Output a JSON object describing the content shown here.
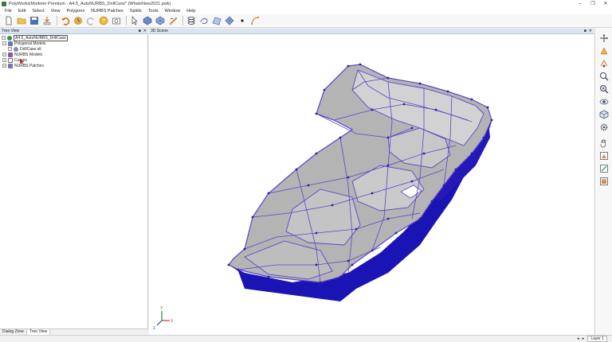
{
  "window": {
    "title": "PolyWorks|Modeler Premium - A4.5_AutoNURBS_DrillCase* (WhatsNew2021.pwk)",
    "controls": [
      "–",
      "❐",
      "✕"
    ]
  },
  "menu": [
    "File",
    "Edit",
    "Select",
    "View",
    "Polygons",
    "NURBS Patches",
    "Splids",
    "Tools",
    "Window",
    "Help"
  ],
  "toolbar": {
    "icons": [
      "new-file-icon",
      "open-folder-icon",
      "save-icon",
      "import-icon",
      "undo-icon",
      "undo-history-icon",
      "redo-icon",
      "help-icon",
      "screenshot-icon",
      "pointer-tool-icon",
      "polygon-tool-icon",
      "mesh-tool-icon",
      "ruler-icon",
      "coil-icon",
      "lasso-icon",
      "patch-icon",
      "grid-icon",
      "point-icon",
      "curve-icon"
    ]
  },
  "tree_view": {
    "header": "Tree View",
    "header_controls": [
      "■",
      "✕"
    ],
    "items": [
      {
        "label": "A4.5_AutoNURBS_DrillCase",
        "level": 0,
        "expander": "−",
        "selected": true,
        "color": "#3f8f3f"
      },
      {
        "label": "Polygonal Models",
        "level": 1,
        "expander": "−",
        "color": "#7a6fb0"
      },
      {
        "label": "DrillCase.stl",
        "level": 2,
        "expander": "+",
        "color": "#8a8aa8"
      },
      {
        "label": "NURBS Models",
        "level": 1,
        "expander": "+",
        "color": "#8a5a9a"
      },
      {
        "label": "Curves",
        "level": 1,
        "expander": "+",
        "color": "#c0392b"
      },
      {
        "label": "NURBS Patches",
        "level": 1,
        "expander": "+",
        "color": "#7a6fb0"
      }
    ]
  },
  "bottom_tabs": [
    "Dialog Zone",
    "Tree View"
  ],
  "scene": {
    "header": "3D Scene",
    "header_controls": [
      "■",
      "✕"
    ],
    "axis_labels": [
      "X",
      "Y",
      "Z"
    ],
    "colors": {
      "surface": "#b4b4b4",
      "surface_light": "#d2d2d2",
      "curves": "#5a46c8",
      "underside": "#1a14b4",
      "nodes": "#2a1fa0"
    }
  },
  "right_toolbar": {
    "icons": [
      "move-axes-icon",
      "zoom-in-icon",
      "rotate-icon",
      "zoom-icon",
      "fit-view-icon",
      "eye-icon",
      "view-cube-icon",
      "settings-icon",
      "hand-pan-icon",
      "view-front-icon",
      "view-side-icon",
      "view-top-icon"
    ]
  },
  "status": {
    "layer": "Layer 1",
    "icons": [
      "status-left-icon",
      "status-right-icon"
    ]
  }
}
